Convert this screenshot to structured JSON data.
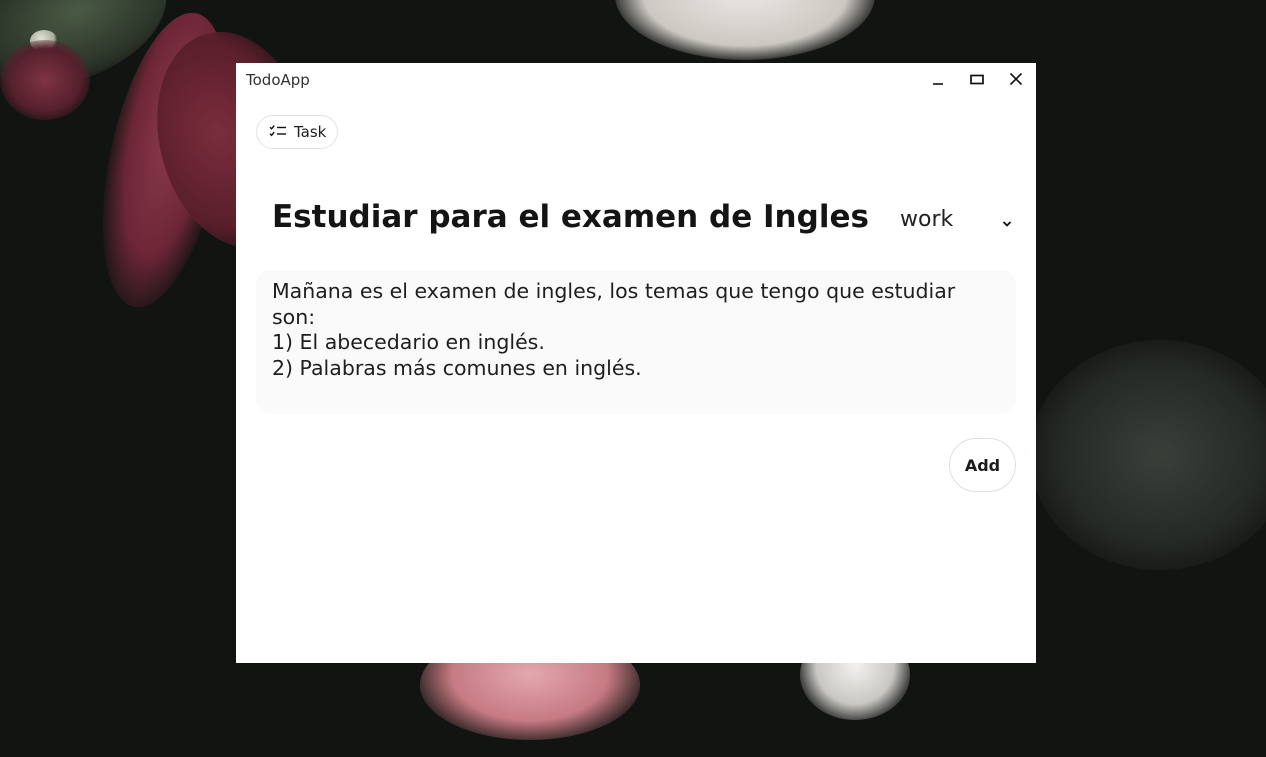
{
  "window": {
    "title": "TodoApp",
    "controls": {
      "minimize_icon": "minimize-icon",
      "maximize_icon": "maximize-icon",
      "close_icon": "close-icon"
    }
  },
  "nav": {
    "task_chip": {
      "label": "Task",
      "icon": "checklist-icon"
    }
  },
  "task": {
    "title": "Estudiar para el examen de Ingles",
    "category": {
      "selected": "work",
      "icon": "chevron-down-icon"
    },
    "description_lines": [
      "Mañana es el examen de ingles, los temas que tengo que estudiar",
      "son:",
      "1) El abecedario en inglés.",
      "2) Palabras más comunes en inglés."
    ]
  },
  "actions": {
    "add_label": "Add"
  },
  "colors": {
    "window_bg": "#ffffff",
    "description_bg": "#fafafa",
    "border": "#e0e0e0",
    "text": "#141414"
  }
}
